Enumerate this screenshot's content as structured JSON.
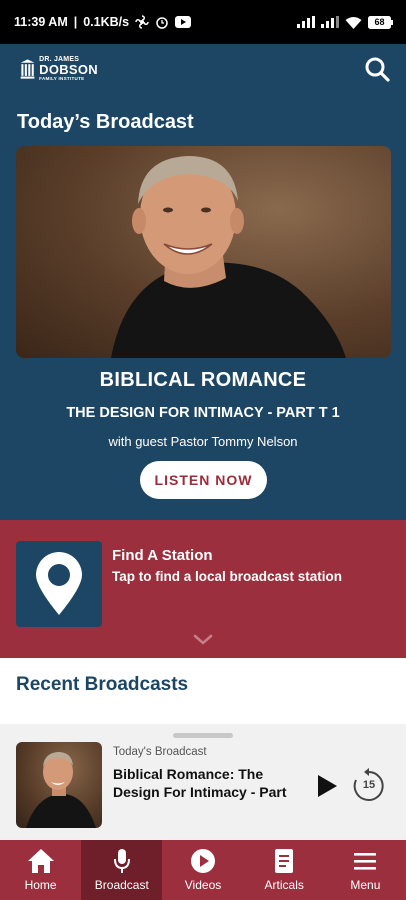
{
  "status_bar": {
    "time": "11:39 AM",
    "speed": "0.1KB/s",
    "battery": "68"
  },
  "header": {
    "logo_line1": "DR. JAMES",
    "logo_line2": "DOBSON",
    "logo_line3": "FAMILY INSTITUTE",
    "search_icon": "search-icon"
  },
  "hero": {
    "section_title": "Today’s Broadcast",
    "title": "BIBLICAL ROMANCE",
    "subtitle": "THE DESIGN FOR INTIMACY - PART T 1",
    "guest": "with guest Pastor Tommy Nelson",
    "listen_label": "LISTEN NOW"
  },
  "station": {
    "title": "Find A Station",
    "description": "Tap to find a local broadcast station",
    "icon": "location-pin-icon"
  },
  "recent": {
    "title": "Recent Broadcasts"
  },
  "player": {
    "label": "Today's Broadcast",
    "title": "Biblical Romance: The Design For Intimacy - Part",
    "replay_seconds": "15"
  },
  "bottom_nav": {
    "items": [
      {
        "label": "Home",
        "icon": "home-icon"
      },
      {
        "label": "Broadcast",
        "icon": "microphone-icon"
      },
      {
        "label": "Videos",
        "icon": "play-circle-icon"
      },
      {
        "label": "Articals",
        "icon": "document-icon"
      },
      {
        "label": "Menu",
        "icon": "hamburger-icon"
      }
    ],
    "active_index": 1
  },
  "colors": {
    "navy": "#1d4664",
    "crimson": "#9b2f3e",
    "crimson_dark": "#6e1f2a",
    "player_bg": "#f1f1f1"
  }
}
